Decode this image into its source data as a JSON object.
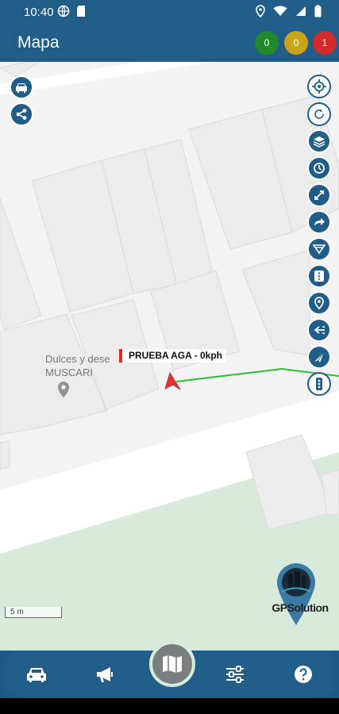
{
  "status_bar": {
    "time": "10:40"
  },
  "app_bar": {
    "title": "Mapa",
    "counters": [
      {
        "value": "0",
        "color": "#1f8a2b"
      },
      {
        "value": "0",
        "color": "#c9a318"
      },
      {
        "value": "1",
        "color": "#d42a2a"
      }
    ]
  },
  "map": {
    "poi": {
      "line1": "Dulces y dese",
      "line2": "MUSCARI"
    },
    "vehicle": {
      "label": "PRUEBA AGA - 0kph"
    },
    "scale": "5 m",
    "logo_text": "GPSolution",
    "right_tools": [
      "locate-icon",
      "refresh-icon",
      "layers-icon",
      "history-icon",
      "geofence-icon",
      "share-route-icon",
      "filter-icon",
      "road-icon",
      "poi-icon",
      "route-icon",
      "navigate-icon",
      "traffic-icon"
    ]
  },
  "colors": {
    "primary": "#215d89",
    "track": "#2bbf2b",
    "vehicle": "#e03333",
    "park": "#d8ebdb"
  },
  "bottom_nav": [
    "car-icon",
    "megaphone-icon",
    "map-icon",
    "sliders-icon",
    "help-icon"
  ]
}
